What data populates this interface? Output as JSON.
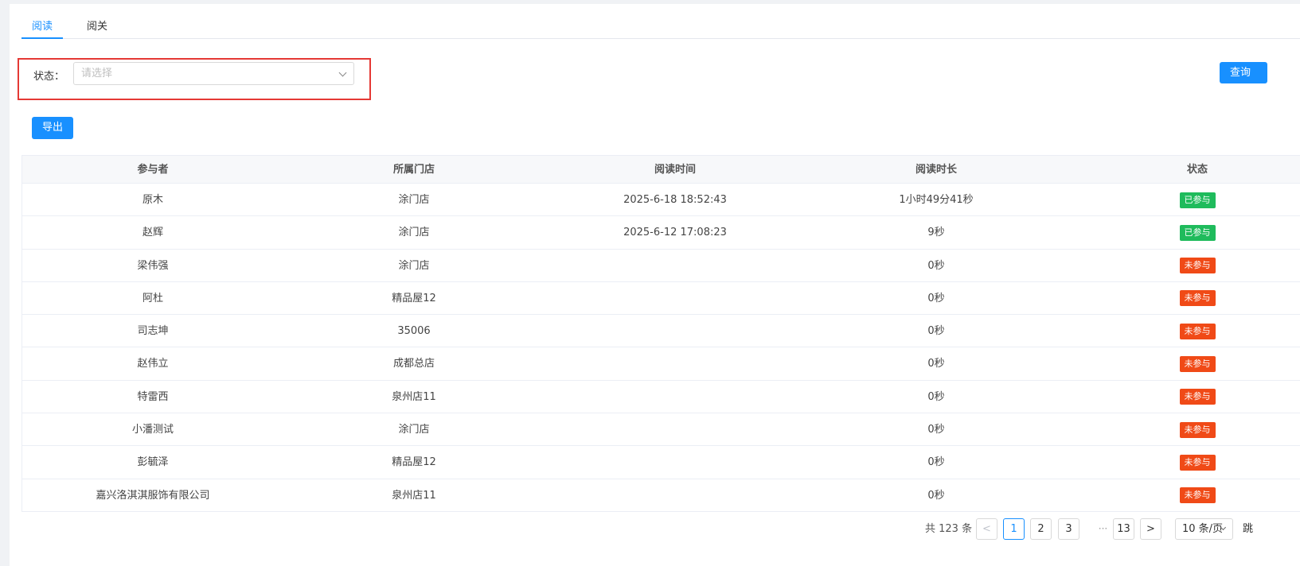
{
  "tabs": [
    {
      "label": "阅读",
      "active": true
    },
    {
      "label": "阅关",
      "active": false
    }
  ],
  "filter": {
    "label": "状态：",
    "placeholder": "请选择"
  },
  "buttons": {
    "query": "查询",
    "export": "导出"
  },
  "table": {
    "columns": [
      "参与者",
      "所属门店",
      "阅读时间",
      "阅读时长",
      "状态"
    ],
    "rows": [
      {
        "participant": "原木",
        "store": "涂门店",
        "read_time": "2025-6-18 18:52:43",
        "duration": "1小时49分41秒",
        "status": "已参与",
        "status_type": "joined"
      },
      {
        "participant": "赵辉",
        "store": "涂门店",
        "read_time": "2025-6-12 17:08:23",
        "duration": "9秒",
        "status": "已参与",
        "status_type": "joined"
      },
      {
        "participant": "梁伟强",
        "store": "涂门店",
        "read_time": "",
        "duration": "0秒",
        "status": "未参与",
        "status_type": "notjoined"
      },
      {
        "participant": "阿杜",
        "store": "精品屋12",
        "read_time": "",
        "duration": "0秒",
        "status": "未参与",
        "status_type": "notjoined"
      },
      {
        "participant": "司志坤",
        "store": "35006",
        "read_time": "",
        "duration": "0秒",
        "status": "未参与",
        "status_type": "notjoined"
      },
      {
        "participant": "赵伟立",
        "store": "成都总店",
        "read_time": "",
        "duration": "0秒",
        "status": "未参与",
        "status_type": "notjoined"
      },
      {
        "participant": "特雷西",
        "store": "泉州店11",
        "read_time": "",
        "duration": "0秒",
        "status": "未参与",
        "status_type": "notjoined"
      },
      {
        "participant": "小潘测试",
        "store": "涂门店",
        "read_time": "",
        "duration": "0秒",
        "status": "未参与",
        "status_type": "notjoined"
      },
      {
        "participant": "彭毓泽",
        "store": "精品屋12",
        "read_time": "",
        "duration": "0秒",
        "status": "未参与",
        "status_type": "notjoined"
      },
      {
        "participant": "嘉兴洛淇淇服饰有限公司",
        "store": "泉州店11",
        "read_time": "",
        "duration": "0秒",
        "status": "未参与",
        "status_type": "notjoined"
      }
    ]
  },
  "pagination": {
    "total_text": "共 123 条",
    "prev": "<",
    "pages": [
      "1",
      "2",
      "3"
    ],
    "current": "1",
    "ellipsis": "···",
    "last_page": "13",
    "next": ">",
    "page_size": "10 条/页",
    "jump_label": "跳"
  },
  "colors": {
    "primary": "#1890ff",
    "joined": "#1fbb5c",
    "notjoined": "#f04a17",
    "highlight": "#e53935"
  },
  "icons": {
    "select_chevron": "chevron-down-icon"
  }
}
